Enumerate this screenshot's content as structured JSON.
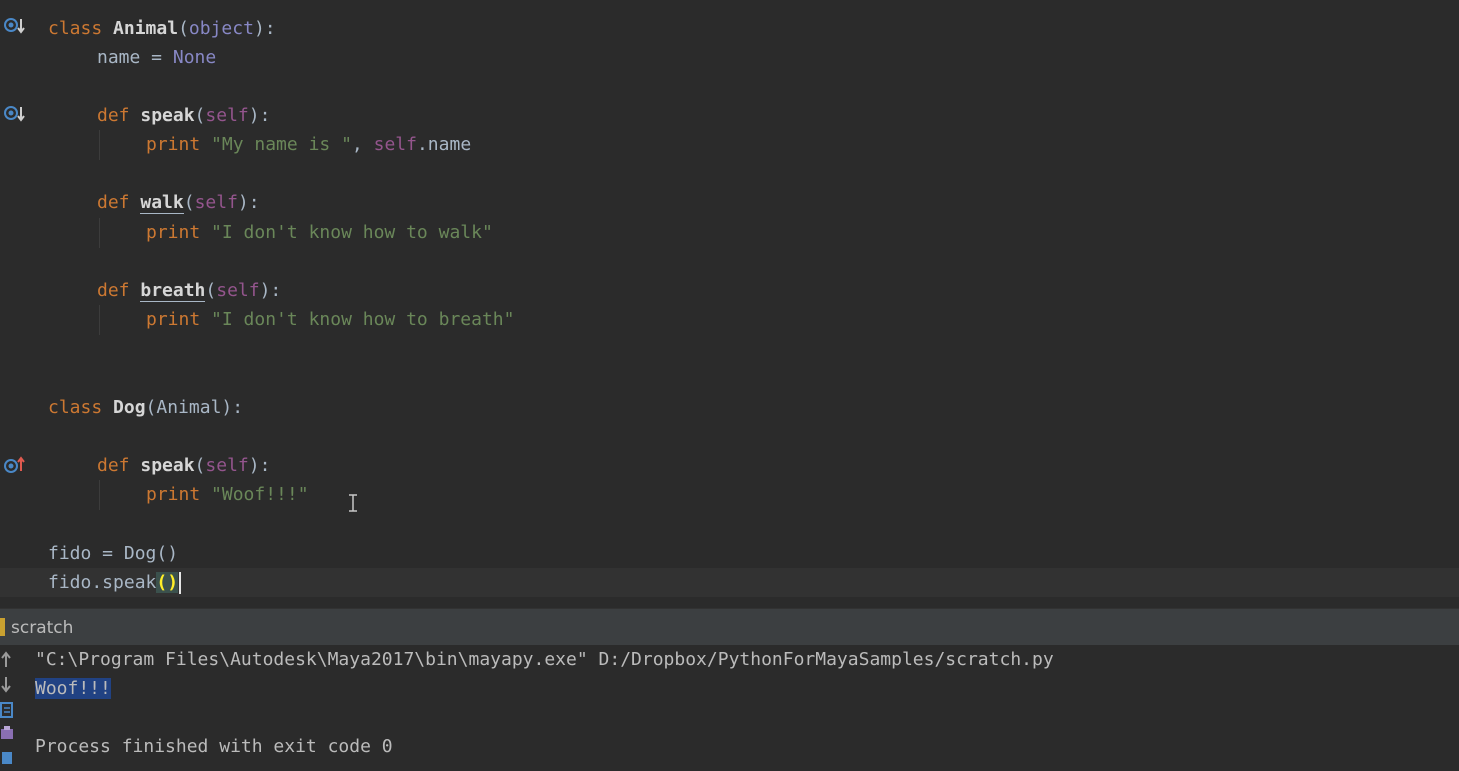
{
  "editor": {
    "lines": {
      "l1": {
        "kw": "class",
        "name": "Animal",
        "open": "(",
        "base": "object",
        "close": "):"
      },
      "l2": {
        "text": "name = ",
        "value": "None"
      },
      "l4": {
        "kw": "def",
        "name": "speak",
        "open": "(",
        "self": "self",
        "close": "):"
      },
      "l5": {
        "kw": "print",
        "str": "\"My name is \"",
        "sep": ", ",
        "self": "self",
        "attr": ".name"
      },
      "l7": {
        "kw": "def",
        "name": "walk",
        "open": "(",
        "self": "self",
        "close": "):"
      },
      "l8": {
        "kw": "print",
        "str": "\"I don't know how to walk\""
      },
      "l10": {
        "kw": "def",
        "name": "breath",
        "open": "(",
        "self": "self",
        "close": "):"
      },
      "l11": {
        "kw": "print",
        "str": "\"I don't know how to breath\""
      },
      "l14": {
        "kw": "class",
        "name": "Dog",
        "rest": "(Animal):"
      },
      "l16": {
        "kw": "def",
        "name": "speak",
        "open": "(",
        "self": "self",
        "close": "):"
      },
      "l17": {
        "kw": "print",
        "str": "\"Woof!!!\""
      },
      "l19": {
        "text": "fido = Dog()"
      },
      "l20": {
        "text": "fido.speak",
        "parens": "()"
      }
    },
    "gutter_icons": [
      "overridden-method-icon",
      "overridden-method-icon",
      "overriding-method-icon"
    ]
  },
  "run_panel": {
    "title": "scratch",
    "console": {
      "command": "\"C:\\Program Files\\Autodesk\\Maya2017\\bin\\mayapy.exe\" D:/Dropbox/PythonForMayaSamples/scratch.py",
      "output": "Woof!!!",
      "exit": "Process finished with exit code 0"
    },
    "toolbar": [
      "rerun-up-icon",
      "rerun-down-icon",
      "soft-wrap-icon",
      "print-icon",
      "pin-icon"
    ]
  },
  "colors": {
    "background": "#2b2b2b",
    "keyword": "#cc7832",
    "string": "#6a8759",
    "self": "#94558d",
    "builtin_const": "#8888c6",
    "selection": "#214283"
  }
}
